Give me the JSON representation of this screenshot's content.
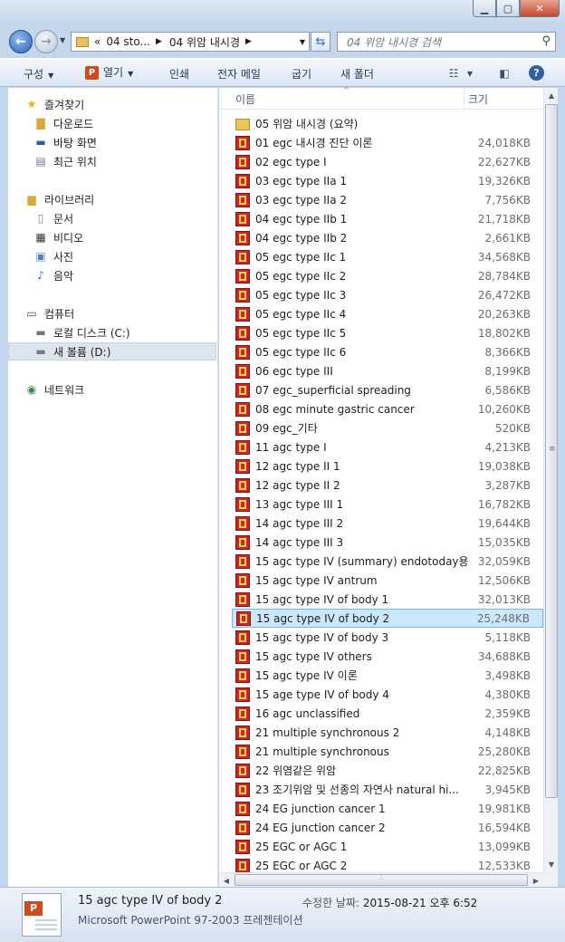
{
  "window": {
    "minimize_glyph": "▁",
    "maximize_glyph": "▢",
    "close_glyph": "✕"
  },
  "address": {
    "overflow": "«",
    "crumbs": [
      "04 sto...",
      "04 위암 내시경"
    ],
    "search_placeholder": "04 위암 내시경 검색"
  },
  "toolbar": {
    "organize": "구성",
    "open": "열기",
    "print": "인쇄",
    "email": "전자 메일",
    "share": "굽기",
    "new_folder": "새 폴더"
  },
  "nav": {
    "favorites": "즐겨찾기",
    "downloads": "다운로드",
    "desktop": "바탕 화면",
    "recent": "최근 위치",
    "libraries": "라이브러리",
    "documents": "문서",
    "videos": "비디오",
    "pictures": "사진",
    "music": "음악",
    "computer": "컴퓨터",
    "local_disk": "로컬 디스크 (C:)",
    "new_volume": "새 볼륨 (D:)",
    "network": "네트워크"
  },
  "columns": {
    "name": "이름",
    "size": "크기"
  },
  "files": [
    {
      "name": "05 위암 내시경 (요약)",
      "size": "",
      "type": "folder"
    },
    {
      "name": "01 egc 내시경 진단 이론",
      "size": "24,018KB",
      "type": "ppt"
    },
    {
      "name": "02 egc type I",
      "size": "22,627KB",
      "type": "ppt"
    },
    {
      "name": "03 egc type IIa 1",
      "size": "19,326KB",
      "type": "ppt"
    },
    {
      "name": "03 egc type IIa 2",
      "size": "7,756KB",
      "type": "ppt"
    },
    {
      "name": "04 egc type IIb 1",
      "size": "21,718KB",
      "type": "ppt"
    },
    {
      "name": "04 egc type IIb 2",
      "size": "2,661KB",
      "type": "ppt"
    },
    {
      "name": "05 egc type IIc 1",
      "size": "34,568KB",
      "type": "ppt"
    },
    {
      "name": "05 egc type IIc 2",
      "size": "28,784KB",
      "type": "ppt"
    },
    {
      "name": "05 egc type IIc 3",
      "size": "26,472KB",
      "type": "ppt"
    },
    {
      "name": "05 egc type IIc 4",
      "size": "20,263KB",
      "type": "ppt"
    },
    {
      "name": "05 egc type IIc 5",
      "size": "18,802KB",
      "type": "ppt"
    },
    {
      "name": "05 egc type IIc 6",
      "size": "8,366KB",
      "type": "ppt"
    },
    {
      "name": "06 egc type III",
      "size": "8,199KB",
      "type": "ppt"
    },
    {
      "name": "07 egc_superficial spreading",
      "size": "6,586KB",
      "type": "ppt"
    },
    {
      "name": "08 egc minute gastric cancer",
      "size": "10,260KB",
      "type": "ppt"
    },
    {
      "name": "09 egc_기타",
      "size": "520KB",
      "type": "ppt"
    },
    {
      "name": "11 agc type I",
      "size": "4,213KB",
      "type": "ppt"
    },
    {
      "name": "12 agc type II 1",
      "size": "19,038KB",
      "type": "ppt"
    },
    {
      "name": "12 agc type II 2",
      "size": "3,287KB",
      "type": "ppt"
    },
    {
      "name": "13 agc type III 1",
      "size": "16,782KB",
      "type": "ppt"
    },
    {
      "name": "14 agc type III 2",
      "size": "19,644KB",
      "type": "ppt"
    },
    {
      "name": "14 agc type III 3",
      "size": "15,035KB",
      "type": "ppt"
    },
    {
      "name": "15 agc type IV (summary) endotoday용",
      "size": "32,059KB",
      "type": "ppt"
    },
    {
      "name": "15 agc type IV antrum",
      "size": "12,506KB",
      "type": "ppt"
    },
    {
      "name": "15 agc type IV of body 1",
      "size": "32,013KB",
      "type": "ppt"
    },
    {
      "name": "15 agc type IV of body 2",
      "size": "25,248KB",
      "type": "ppt",
      "selected": true
    },
    {
      "name": "15 agc type IV of body 3",
      "size": "5,118KB",
      "type": "ppt"
    },
    {
      "name": "15 agc type IV others",
      "size": "34,688KB",
      "type": "ppt"
    },
    {
      "name": "15 agc type IV 이론",
      "size": "3,498KB",
      "type": "ppt"
    },
    {
      "name": "15 age type IV of body 4",
      "size": "4,380KB",
      "type": "ppt"
    },
    {
      "name": "16 agc unclassified",
      "size": "2,359KB",
      "type": "ppt"
    },
    {
      "name": "21 multiple synchronous 2",
      "size": "4,148KB",
      "type": "ppt"
    },
    {
      "name": "21 multiple synchronous",
      "size": "25,280KB",
      "type": "ppt"
    },
    {
      "name": "22 위염같은 위암",
      "size": "22,825KB",
      "type": "ppt"
    },
    {
      "name": "23 조기위암 및 선종의 자연사 natural hi...",
      "size": "3,945KB",
      "type": "ppt"
    },
    {
      "name": "24 EG junction cancer 1",
      "size": "19,981KB",
      "type": "ppt"
    },
    {
      "name": "24 EG junction cancer 2",
      "size": "16,594KB",
      "type": "ppt"
    },
    {
      "name": "25 EGC or AGC 1",
      "size": "13,099KB",
      "type": "ppt"
    },
    {
      "name": "25 EGC or AGC 2",
      "size": "12,533KB",
      "type": "ppt"
    }
  ],
  "details": {
    "name": "15 agc type IV of body 2",
    "type": "Microsoft PowerPoint 97-2003 프레젠테이션",
    "modified_label": "수정한 날짜:",
    "modified_value": "2015-08-21 오후 6:52"
  }
}
